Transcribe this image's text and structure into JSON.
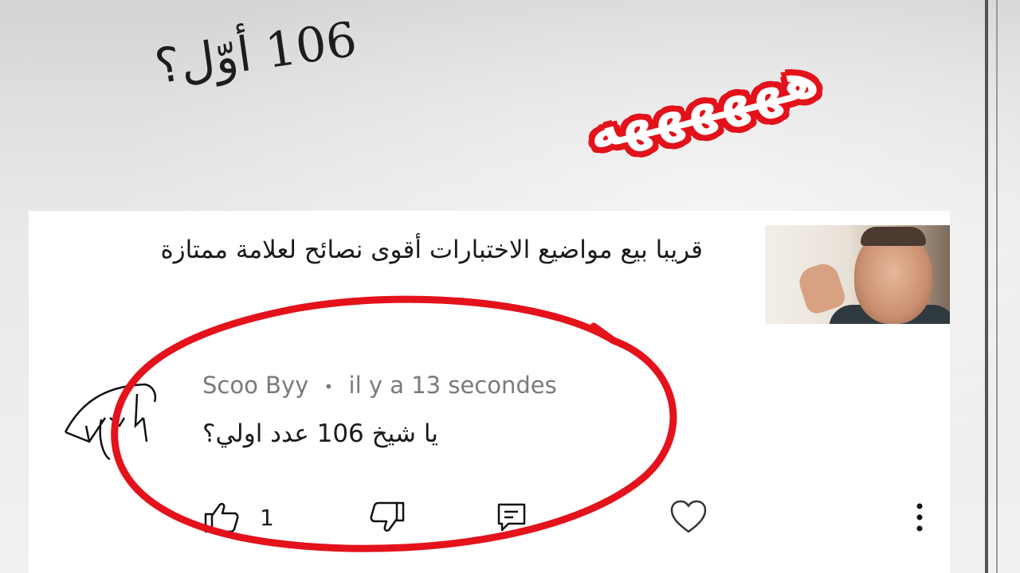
{
  "whiteboard": {
    "handwritten_text": "106 أوّل؟"
  },
  "sticker": {
    "text": "ههههههه"
  },
  "post": {
    "text": "قريبا بيع مواضيع الاختبارات أقوى نصائح لعلامة ممتازة"
  },
  "comment": {
    "author": "Scoo Byy",
    "separator": "•",
    "timestamp": "il y a 13 secondes",
    "body": "يا شيخ 106 عدد اولي؟",
    "like_count": "1"
  },
  "icons": {
    "like": "thumbs-up-icon",
    "dislike": "thumbs-down-icon",
    "reply": "reply-icon",
    "heart": "heart-icon",
    "more": "more-vertical-icon"
  },
  "colors": {
    "annotation_red": "#e3121b",
    "meta_gray": "#7a7a7a",
    "text": "#1a1a1a"
  }
}
